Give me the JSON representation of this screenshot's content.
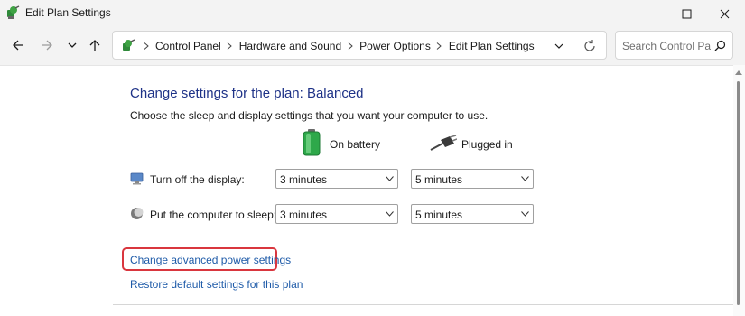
{
  "window": {
    "title": "Edit Plan Settings",
    "icon": "power-plan-icon",
    "controls": [
      "minimize-icon",
      "maximize-icon",
      "close-icon"
    ]
  },
  "navigation": {
    "buttons": [
      "back-arrow-icon",
      "forward-arrow-icon",
      "recent-dropdown-icon",
      "up-arrow-icon"
    ],
    "breadcrumbs": [
      "Control Panel",
      "Hardware and Sound",
      "Power Options",
      "Edit Plan Settings"
    ],
    "search_placeholder": "Search Control Pa..."
  },
  "main": {
    "heading": "Change settings for the plan: Balanced",
    "description": "Choose the sleep and display settings that you want your computer to use.",
    "columns": {
      "battery": "On battery",
      "plugged": "Plugged in"
    },
    "rows": [
      {
        "label": "Turn off the display:",
        "icon": "monitor-icon",
        "battery_value": "3 minutes",
        "plugged_value": "5 minutes"
      },
      {
        "label": "Put the computer to sleep:",
        "icon": "moon-icon",
        "battery_value": "3 minutes",
        "plugged_value": "5 minutes"
      }
    ],
    "links": {
      "advanced": "Change advanced power settings",
      "restore": "Restore default settings for this plan"
    }
  },
  "colors": {
    "heading": "#1e3287",
    "link": "#1d5aa8",
    "highlight": "#d9363e"
  }
}
